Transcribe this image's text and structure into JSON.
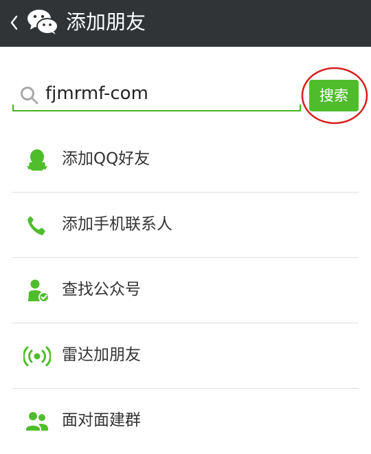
{
  "header": {
    "title": "添加朋友"
  },
  "search": {
    "value": "fjmrmf-com",
    "button_label": "搜索"
  },
  "menu": [
    {
      "label": "添加QQ好友",
      "icon": "qq-penguin-icon"
    },
    {
      "label": "添加手机联系人",
      "icon": "phone-icon"
    },
    {
      "label": "查找公众号",
      "icon": "official-account-icon"
    },
    {
      "label": "雷达加朋友",
      "icon": "radar-icon"
    },
    {
      "label": "面对面建群",
      "icon": "group-icon"
    }
  ],
  "colors": {
    "header_background": "#303437",
    "accent_green": "#4fbd2b",
    "highlight_red": "#d81b1b"
  }
}
